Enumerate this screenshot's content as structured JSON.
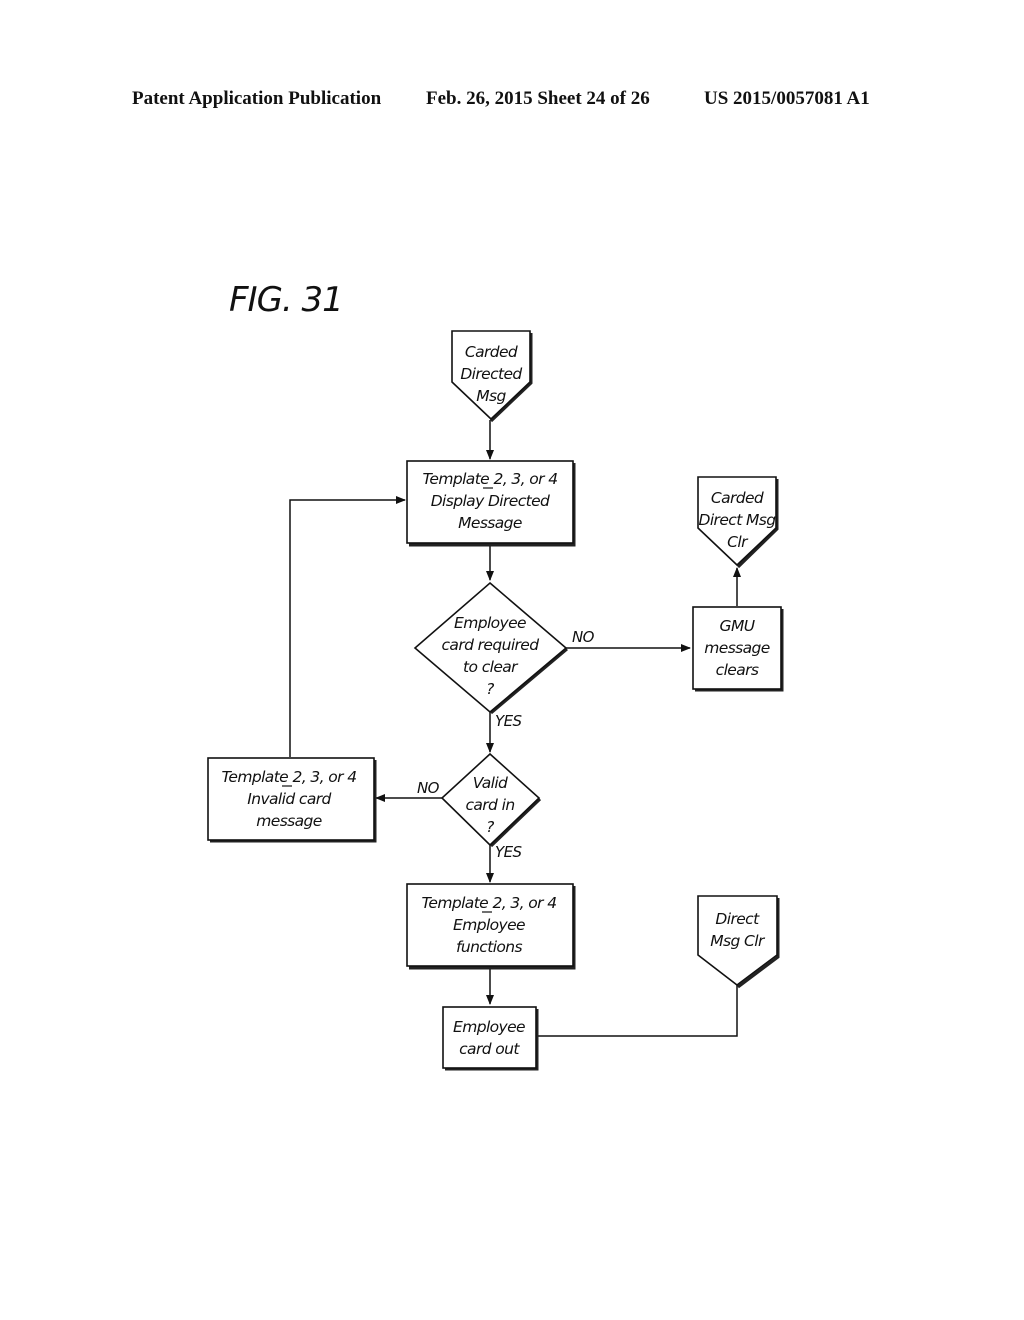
{
  "header": {
    "publication": "Patent Application Publication",
    "date_sheet": "Feb. 26, 2015   Sheet 24 of 26",
    "patent_number": "US 2015/0057081 A1"
  },
  "figure": {
    "title": "FIG. 31",
    "nodes": {
      "start": {
        "type": "off-page-connector",
        "lines": [
          "Carded",
          "Directed",
          "Msg"
        ]
      },
      "display": {
        "type": "process",
        "lines": [
          "Template 2, 3, or 4",
          "Display Directed",
          "Message"
        ]
      },
      "decision1": {
        "type": "decision",
        "lines": [
          "Employee",
          "card required",
          "to clear",
          "?"
        ]
      },
      "gmu": {
        "type": "process",
        "lines": [
          "GMU",
          "message",
          "clears"
        ]
      },
      "end1": {
        "type": "off-page-connector",
        "lines": [
          "Carded",
          "Direct Msg",
          "Clr"
        ]
      },
      "decision2": {
        "type": "decision",
        "lines": [
          "Valid",
          "card in",
          "?"
        ]
      },
      "invalid": {
        "type": "process",
        "lines": [
          "Template 2, 3, or 4",
          "Invalid card",
          "message"
        ]
      },
      "employee_functions": {
        "type": "process",
        "lines": [
          "Template 2, 3, or 4",
          "Employee",
          "functions"
        ]
      },
      "card_out": {
        "type": "process",
        "lines": [
          "Employee",
          "card out"
        ]
      },
      "end2": {
        "type": "off-page-connector",
        "lines": [
          "Direct",
          "Msg Clr"
        ]
      }
    },
    "edges": {
      "d1_no": "NO",
      "d1_yes": "YES",
      "d2_no": "NO",
      "d2_yes": "YES"
    }
  }
}
